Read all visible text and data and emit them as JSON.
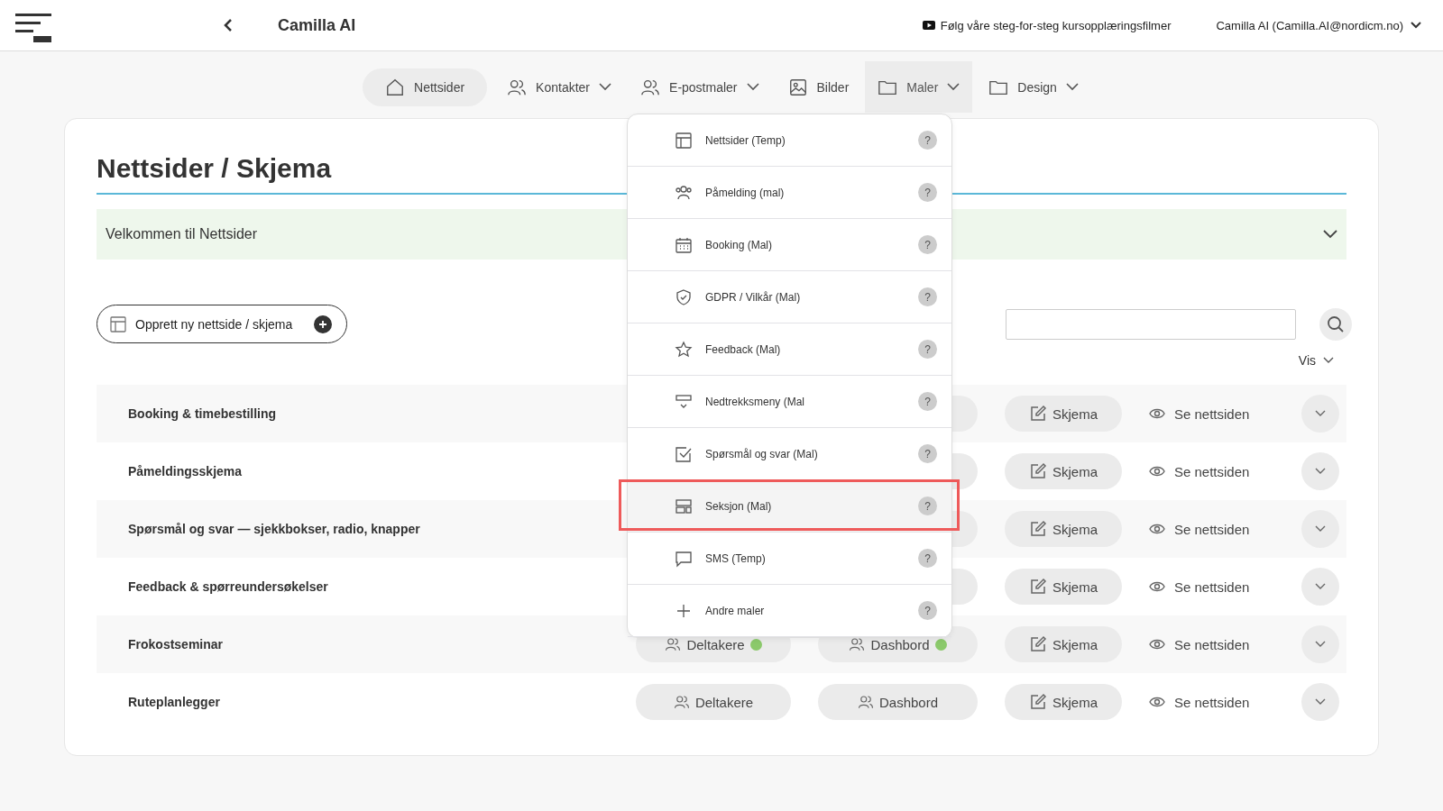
{
  "header": {
    "title": "Camilla AI",
    "tutorial_link": "Følg våre steg-for-steg kursopplæringsfilmer",
    "user": "Camilla AI (Camilla.AI@nordicm.no)"
  },
  "nav": [
    {
      "label": "Nettsider",
      "selected": true,
      "expanded": false,
      "has_caret": false
    },
    {
      "label": "Kontakter",
      "selected": false,
      "expanded": false,
      "has_caret": true
    },
    {
      "label": "E-postmaler",
      "selected": false,
      "expanded": false,
      "has_caret": true
    },
    {
      "label": "Bilder",
      "selected": false,
      "expanded": false,
      "has_caret": false
    },
    {
      "label": "Maler",
      "selected": false,
      "expanded": true,
      "has_caret": true
    },
    {
      "label": "Design",
      "selected": false,
      "expanded": false,
      "has_caret": true
    }
  ],
  "dropdown": [
    {
      "label": "Nettsider (Temp)",
      "help": "?",
      "highlighted": false
    },
    {
      "label": "Påmelding (mal)",
      "help": "?",
      "highlighted": false
    },
    {
      "label": "Booking (Mal)",
      "help": "?",
      "highlighted": false
    },
    {
      "label": "GDPR / Vilkår (Mal)",
      "help": "?",
      "highlighted": false
    },
    {
      "label": "Feedback (Mal)",
      "help": "?",
      "highlighted": false
    },
    {
      "label": "Nedtrekksmeny (Mal",
      "help": "?",
      "highlighted": false
    },
    {
      "label": "Spørsmål og svar (Mal)",
      "help": "?",
      "highlighted": false
    },
    {
      "label": "Seksjon (Mal)",
      "help": "?",
      "highlighted": true
    },
    {
      "label": "SMS (Temp)",
      "help": "?",
      "highlighted": false
    },
    {
      "label": "Andre maler",
      "help": "?",
      "highlighted": false
    }
  ],
  "page": {
    "title": "Nettsider / Skjema",
    "welcome": "Velkommen til Nettsider",
    "create_button": "Opprett ny nettside / skjema",
    "vis": "Vis"
  },
  "rows": [
    {
      "name": "Booking & timebestilling",
      "skjema": "Skjema",
      "view": "Se nettsiden"
    },
    {
      "name": "Påmeldingsskjema",
      "skjema": "Skjema",
      "view": "Se nettsiden"
    },
    {
      "name": "Spørsmål og svar — sjekkbokser, radio, knapper",
      "skjema": "Skjema",
      "view": "Se nettsiden"
    },
    {
      "name": "Feedback & spørreundersøkelser",
      "skjema": "Skjema",
      "view": "Se nettsiden"
    },
    {
      "name": "Frokostseminar",
      "deltakere": {
        "label": "Deltakere",
        "active": true
      },
      "dashbord": {
        "label": "Dashbord",
        "active": true
      },
      "skjema": "Skjema",
      "view": "Se nettsiden"
    },
    {
      "name": "Ruteplanlegger",
      "deltakere": {
        "label": "Deltakere",
        "active": false
      },
      "dashbord": {
        "label": "Dashbord",
        "active": false
      },
      "skjema": "Skjema",
      "view": "Se nettsiden"
    }
  ]
}
